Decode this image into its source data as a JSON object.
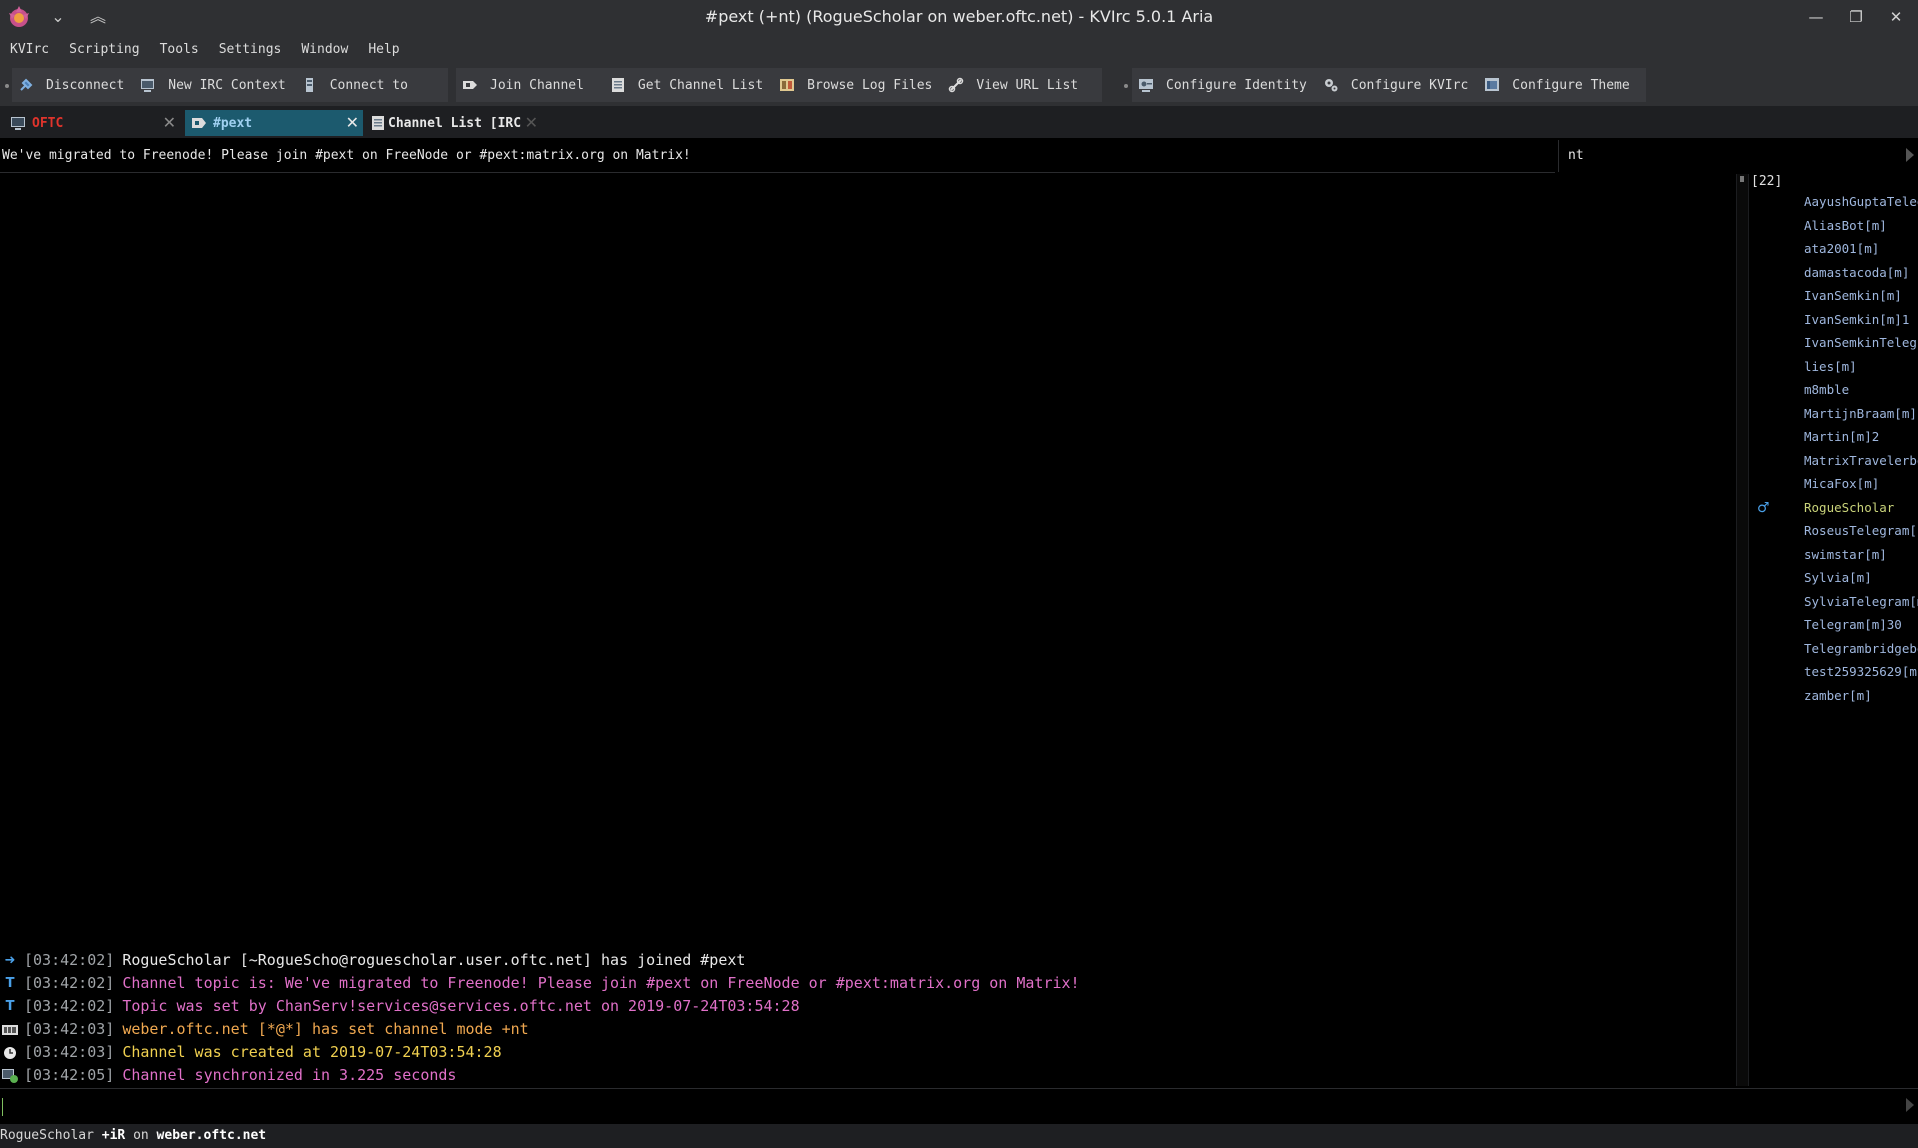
{
  "window": {
    "title": "#pext (+nt) (RogueScholar on weber.oftc.net) - KVIrc 5.0.1 Aria"
  },
  "menubar": {
    "items": [
      "KVIrc",
      "Scripting",
      "Tools",
      "Settings",
      "Window",
      "Help"
    ]
  },
  "toolbar": {
    "groups": [
      {
        "buttons": [
          {
            "label": "Disconnect",
            "icon": "plug-icon"
          },
          {
            "label": "New IRC Context",
            "icon": "new-context-icon"
          },
          {
            "label": "Connect to",
            "icon": "server-icon"
          }
        ]
      },
      {
        "buttons": [
          {
            "label": "Join Channel",
            "icon": "join-channel-icon"
          },
          {
            "label": "Get Channel List",
            "icon": "channel-list-icon"
          },
          {
            "label": "Browse Log Files",
            "icon": "log-files-icon"
          },
          {
            "label": "View URL List",
            "icon": "link-icon"
          }
        ]
      },
      {
        "buttons": [
          {
            "label": "Configure Identity",
            "icon": "identity-icon"
          },
          {
            "label": "Configure KVIrc",
            "icon": "gears-icon"
          },
          {
            "label": "Configure Theme",
            "icon": "theme-icon"
          }
        ]
      }
    ]
  },
  "tabs": [
    {
      "label": "OFTC",
      "color": "#e0342c",
      "active": false
    },
    {
      "label": "#pext",
      "color": "#9fd0f0",
      "active": true
    },
    {
      "label": "Channel List [IRC",
      "color": "#e8e8e8",
      "active": false
    }
  ],
  "channel": {
    "topic": "We've migrated to Freenode! Please join #pext on FreeNode or #pext:matrix.org on Matrix!",
    "mode": "nt",
    "user_count": "[22]"
  },
  "messages": [
    {
      "icon": "join-arrow-icon",
      "time": "[03:42:02]",
      "text": "RogueScholar [~RogueScho@roguescholar.user.oftc.net] has joined #pext",
      "color": "#e8e8e8"
    },
    {
      "icon": "topic-icon",
      "time": "[03:42:02]",
      "text": "Channel topic is: We've migrated to Freenode! Please join #pext on FreeNode or #pext:matrix.org on Matrix!",
      "color": "#e070c8"
    },
    {
      "icon": "topic-icon",
      "time": "[03:42:02]",
      "text": "Topic was set by ChanServ!services@services.oftc.net on 2019-07-24T03:54:28",
      "color": "#e070c8"
    },
    {
      "icon": "mode-icon",
      "time": "[03:42:03]",
      "text": "weber.oftc.net [*@*] has set channel mode +nt",
      "color": "#f0a850"
    },
    {
      "icon": "clock-icon",
      "time": "[03:42:03]",
      "text": "Channel was created at 2019-07-24T03:54:28",
      "color": "#f0d050"
    },
    {
      "icon": "sync-icon",
      "time": "[03:42:05]",
      "text": "Channel synchronized in 3.225 seconds",
      "color": "#e070c8"
    }
  ],
  "users": [
    "AayushGuptaTeleg",
    "AliasBot[m]",
    "ata2001[m]",
    "damastacoda[m]",
    "IvanSemkin[m]",
    "IvanSemkin[m]1",
    "IvanSemkinTelegr",
    "lies[m]",
    "m8mble",
    "MartijnBraam[m]",
    "Martin[m]2",
    "MatrixTravelerbot",
    "MicaFox[m]",
    "RogueScholar",
    "RoseusTelegram[r",
    "swimstar[m]",
    "Sylvia[m]",
    "SylviaTelegram[m",
    "Telegram[m]30",
    "Telegrambridgebo",
    "test259325629[m",
    "zamber[m]"
  ],
  "self_user": "RogueScholar",
  "status": {
    "nick": "RogueScholar",
    "umode": "+iR",
    "on": "on",
    "server": "weber.oftc.net"
  }
}
